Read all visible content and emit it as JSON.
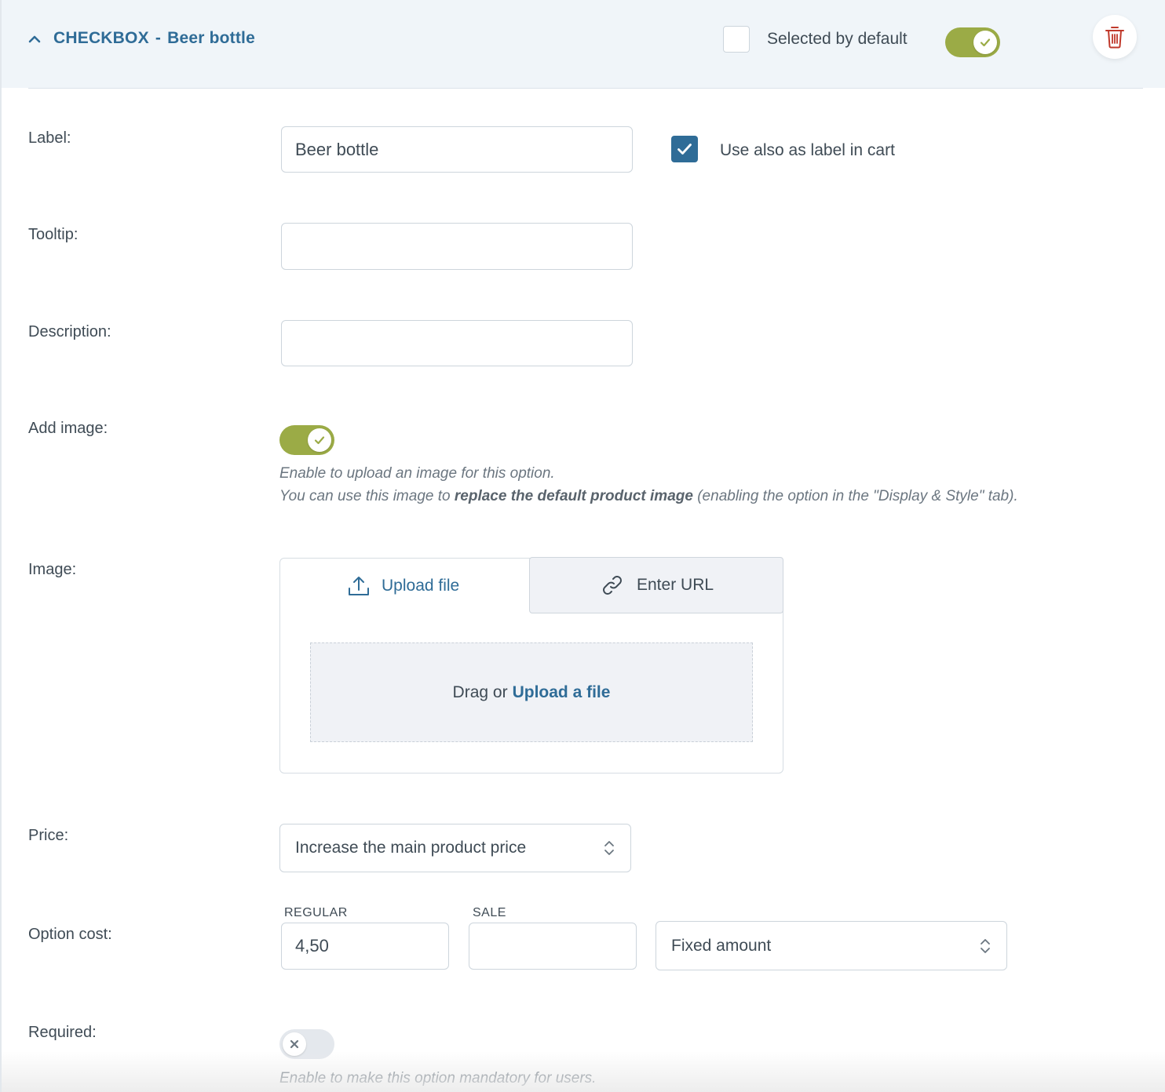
{
  "header": {
    "type_label": "CHECKBOX",
    "separator": "-",
    "option_name": "Beer bottle",
    "selected_default_label": "Selected by default",
    "selected_default_checked": false,
    "enabled_toggle": true,
    "delete_icon": "trash-icon"
  },
  "fields": {
    "label": {
      "caption": "Label:",
      "value": "Beer bottle",
      "use_in_cart_label": "Use also as label in cart",
      "use_in_cart_checked": true
    },
    "tooltip": {
      "caption": "Tooltip:",
      "value": ""
    },
    "description": {
      "caption": "Description:",
      "value": ""
    },
    "add_image": {
      "caption": "Add image:",
      "enabled": true,
      "help_line1": "Enable to upload an image for this option.",
      "help_line2_pre": "You can use this image to ",
      "help_line2_bold": "replace the default product image",
      "help_line2_post": " (enabling the option in the \"Display & Style\" tab)."
    },
    "image": {
      "caption": "Image:",
      "tab_upload": "Upload file",
      "tab_url": "Enter URL",
      "drop_text": "Drag or",
      "drop_link": "Upload a file"
    },
    "price": {
      "caption": "Price:",
      "selected": "Increase the main product price"
    },
    "option_cost": {
      "caption": "Option cost:",
      "regular_label": "REGULAR",
      "regular_value": "4,50",
      "sale_label": "SALE",
      "sale_value": "",
      "type_selected": "Fixed amount"
    },
    "required": {
      "caption": "Required:",
      "enabled": false,
      "help": "Enable to make this option mandatory for users."
    }
  },
  "colors": {
    "accent_blue": "#2f6c97",
    "toggle_on": "#9bab46",
    "danger": "#c0392b",
    "header_bg": "#f0f5f9"
  }
}
